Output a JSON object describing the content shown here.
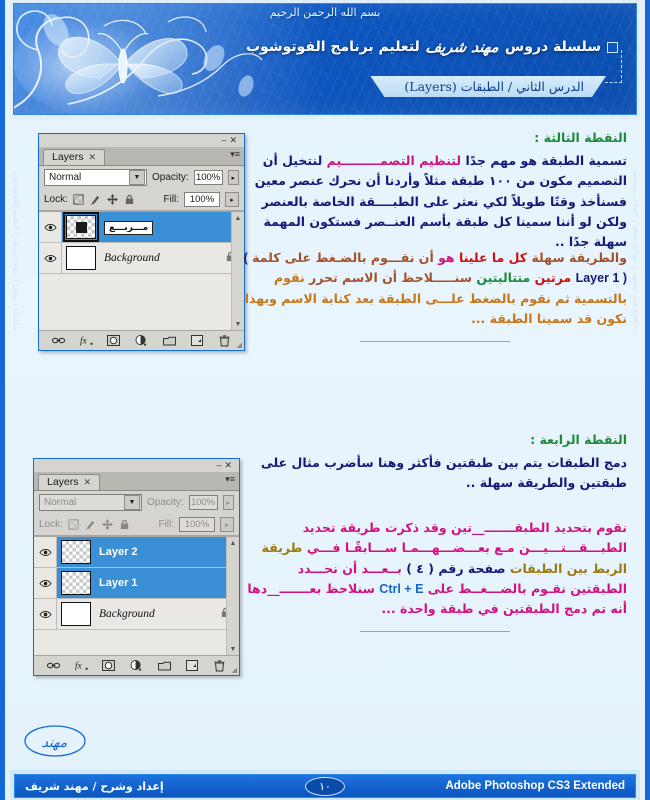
{
  "header": {
    "bismillah": "بسم الله الرحمن الرحيم",
    "series_prefix": "سلسلة دروس",
    "signature": "مهند شريف",
    "series_suffix": "لتعليم برنامج الفوتوشوب",
    "ribbon": "الدرس الثاني /  الطبقات (Layers)"
  },
  "watermark": {
    "text": "سلسلة دروس ( مهند شريف ) لتعليم الفوتوشوب"
  },
  "panel1": {
    "tab_label": "Layers",
    "tab_close": "✕",
    "minimize": "–",
    "close": "✕",
    "blend_mode": "Normal",
    "opacity_label": "Opacity:",
    "opacity_value": "100%",
    "lock_label": "Lock:",
    "fill_label": "Fill:",
    "fill_value": "100%",
    "layers": [
      {
        "name": "مـــربـــع",
        "type": "rename",
        "thumb": "checker-square",
        "locked": false,
        "selected": true
      },
      {
        "name": "Background",
        "type": "background",
        "thumb": "white",
        "locked": true,
        "selected": false
      }
    ],
    "footer_icons": [
      "link-icon",
      "fx-icon",
      "mask-icon",
      "adjustment-icon",
      "folder-icon",
      "new-layer-icon",
      "trash-icon"
    ]
  },
  "panel2": {
    "tab_label": "Layers",
    "tab_close": "✕",
    "minimize": "–",
    "close": "✕",
    "blend_mode": "Normal",
    "opacity_label": "Opacity:",
    "opacity_value": "100%",
    "lock_label": "Lock:",
    "fill_label": "Fill:",
    "fill_value": "100%",
    "layers": [
      {
        "name": "Layer 2",
        "type": "normal",
        "thumb": "checker",
        "locked": false,
        "selected": true
      },
      {
        "name": "Layer 1",
        "type": "normal",
        "thumb": "checker",
        "locked": false,
        "selected": true
      },
      {
        "name": "Background",
        "type": "background",
        "thumb": "white",
        "locked": true,
        "selected": false
      }
    ],
    "footer_icons": [
      "link-icon",
      "fx-icon",
      "mask-icon",
      "adjustment-icon",
      "folder-icon",
      "new-layer-icon",
      "trash-icon"
    ]
  },
  "section3": {
    "heading": "النقطة الثالثة :",
    "p1_a": "تسمية الطبقة هو مهم جدًا",
    "p1_b": "لتنظيم التصمـــــــــيم",
    "p1_c": "لنتخيل أن التصميم مكون من ١٠٠ طبقة مثلاً وأردنا أن نحرك عنصر معين فسنأخذ وقتًا طويلاً لكي نعثر على الطبــــقة الخاصة بالعنصر ولكن لو أننا سمينا كل طبقة بأسم العنــصر فستكون المهمة سهلة جدًا ..",
    "p2_a": "والطريقة سهلة",
    "p2_b": "كل ما علينا",
    "p2_c": "هو",
    "p2_d": "أن نقـــوم بالضـغط  على كلمة",
    "p2_e": "( Layer 1 )",
    "p2_f": "مرتين",
    "p2_g": "متتاليتين",
    "p2_h": "سنـــــلاحظ أن الاسم تحرر",
    "p2_i": "نقوم بالتسمية ثم نقوم بالضغط علـــى الطبقة بعد كتابة الاسم وبهذا نكون قد سمينا الطبقة ..."
  },
  "section4": {
    "heading": "النقطة الرابعة :",
    "p1_a": "دمج الطبقات",
    "p1_b": "يتم بين طبقتين فأكثر وهنا سأضرب مثال على طبقتين والطريقة سهلة ..",
    "p2_a": "نقوم بتحديد الطبقـــــــ__تين وقد ذكرت طريقة تحديد الطبـــقـــتـــيـــن مـع بعـــضـــهـــمـا ســـابقًـا فـــي",
    "p2_b": "طريقة الربط بين الطبقات",
    "p2_c": "صفحة رقم ( ٤ )",
    "p2_d": "بــعـــد أن نحـــدد الطبقتين نقـوم بالضـــغــط على",
    "p2_e": "Ctrl + E",
    "p2_f": "سنلاحظ بعـــــــ__دها أنه تم دمج الطبقتين في طبقة واحدة ..."
  },
  "footer": {
    "left": "Adobe Photoshop CS3 Extended",
    "page": "١٠",
    "right": "إعداد وشرح / مهند شريف"
  }
}
